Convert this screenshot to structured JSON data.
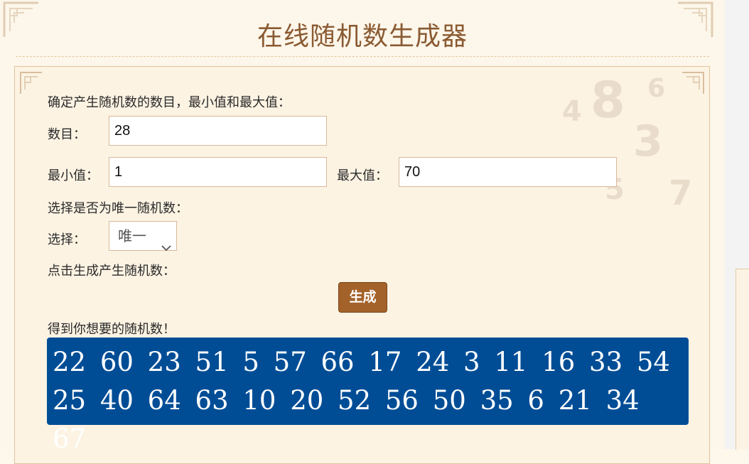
{
  "page": {
    "title": "在线随机数生成器"
  },
  "form": {
    "intro": "确定产生随机数的数目，最小值和最大值：",
    "count_label": "数目：",
    "count_value": "28",
    "min_label": "最小值：",
    "min_value": "1",
    "max_label": "最大值：",
    "max_value": "70",
    "unique_prompt": "选择是否为唯一随机数：",
    "select_label": "选择：",
    "select_value": "唯一",
    "click_prompt": "点击生成产生随机数：",
    "generate_button": "生成",
    "result_prompt": "得到你想要的随机数！",
    "result_numbers": "22 60 23 51 5 57 66 17 24 3 11 16 33 54 25 40 64 63 10 20 52 56 50 35 6 21 34 67"
  },
  "colors": {
    "title": "#8a5a32",
    "button": "#a3622a",
    "result_bg": "#004d96",
    "panel_bg": "#fcf3e3",
    "page_bg": "#fdf6ea"
  }
}
